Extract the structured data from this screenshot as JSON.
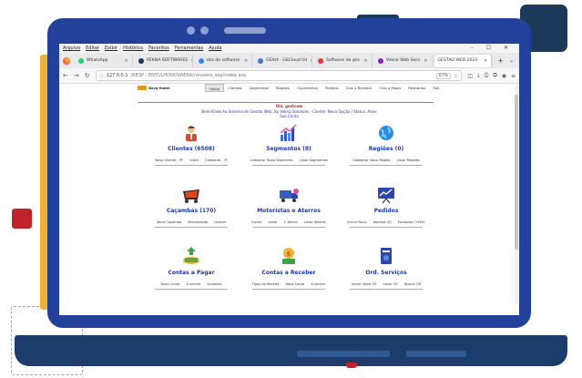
{
  "browser": {
    "menu": [
      "Arquivo",
      "Editar",
      "Exibir",
      "Histórico",
      "Favoritos",
      "Ferramentas",
      "Ajuda"
    ],
    "tabs": [
      {
        "label": "WhatsApp",
        "color": "#25d366"
      },
      {
        "label": "VEKNA SOFTWARES",
        "color": "#1b3a5a"
      },
      {
        "label": "site de software",
        "color": "#4285f4"
      },
      {
        "label": "GSArt - GSCloud Int",
        "color": "#3a7bd5"
      },
      {
        "label": "Software de ges",
        "color": "#e53935"
      },
      {
        "label": "Vekna Web Serv",
        "color": "#8e24aa"
      },
      {
        "label": "GESTAO WEB 2023",
        "color": "#777777"
      }
    ],
    "new_tab_symbol": "+",
    "tab_list_symbol": "⌄",
    "window_controls": "– ☐ ✕",
    "url": {
      "host": "127.0.0.1",
      "path": "/RESP - ENTULHONOVAERA/novaera_asp/index.asp"
    },
    "zoom": "67%"
  },
  "app": {
    "logo_text": "Nova Huder",
    "menu": [
      {
        "label": "Home",
        "active": true
      },
      {
        "label": "Clientes"
      },
      {
        "label": "Segmentos"
      },
      {
        "label": "Regiões"
      },
      {
        "label": "Orçamentos"
      },
      {
        "label": "Pedidos"
      },
      {
        "label": "Ctas a Receber"
      },
      {
        "label": "Ctas a Pagar"
      },
      {
        "label": "Relatórios"
      },
      {
        "label": "Sair"
      }
    ],
    "greeting": {
      "hello": "Olá, gestcom",
      "welcome": "Bem-Vindo Ao Sistema de Gestão Web, By Vekna Solutions - Cliente: Nova Opção / Status: Ativo",
      "account": "Sua Conta"
    },
    "cards": [
      {
        "title": "Clientes (6508)",
        "icon": "user-person-icon",
        "links": [
          "Novo Cliente - PF",
          "Listar",
          "Cadastrar - PJ"
        ]
      },
      {
        "title": "Segmentos (8)",
        "icon": "bar-chart-icon",
        "links": [
          "Cadastrar Novo Segmento",
          "Listar Segmentos"
        ]
      },
      {
        "title": "Regiões (0)",
        "icon": "globe-icon",
        "links": [
          "Cadastrar Nova Região",
          "Listar Regiões"
        ]
      },
      {
        "title": "Caçambas (170)",
        "icon": "dumpster-icon",
        "links": [
          "Nova Caçamba",
          "Manutenção",
          "Liberar"
        ]
      },
      {
        "title": "Motoristas e Aterros",
        "icon": "truck-icon",
        "links": [
          "Incluir",
          "Listar",
          "+ Aterro",
          "Listar Aterros"
        ]
      },
      {
        "title": "Pedidos",
        "icon": "presentation-chart-icon",
        "links": [
          "Incluir Novo",
          "Abertos (0)",
          "Fechados (7409)"
        ]
      },
      {
        "title": "Contas a Pagar",
        "icon": "money-arrow-up-icon",
        "links": [
          "Nova Conta",
          "A vencer",
          "Quitadas"
        ]
      },
      {
        "title": "Contas a Receber",
        "icon": "money-coin-icon",
        "links": [
          "Tipos de Receita",
          "Nova Conta",
          "A vencer"
        ]
      },
      {
        "title": "Ord. Serviços",
        "icon": "service-order-icon",
        "links": [
          "Incluir Nova OS",
          "Listar OS",
          "Buscar OS"
        ]
      }
    ]
  },
  "colors": {
    "frame": "#23419a",
    "accent_red": "#c0232c",
    "accent_orange": "#f2b136",
    "navy": "#1b3a5a",
    "title_blue": "#1f3aa0"
  }
}
